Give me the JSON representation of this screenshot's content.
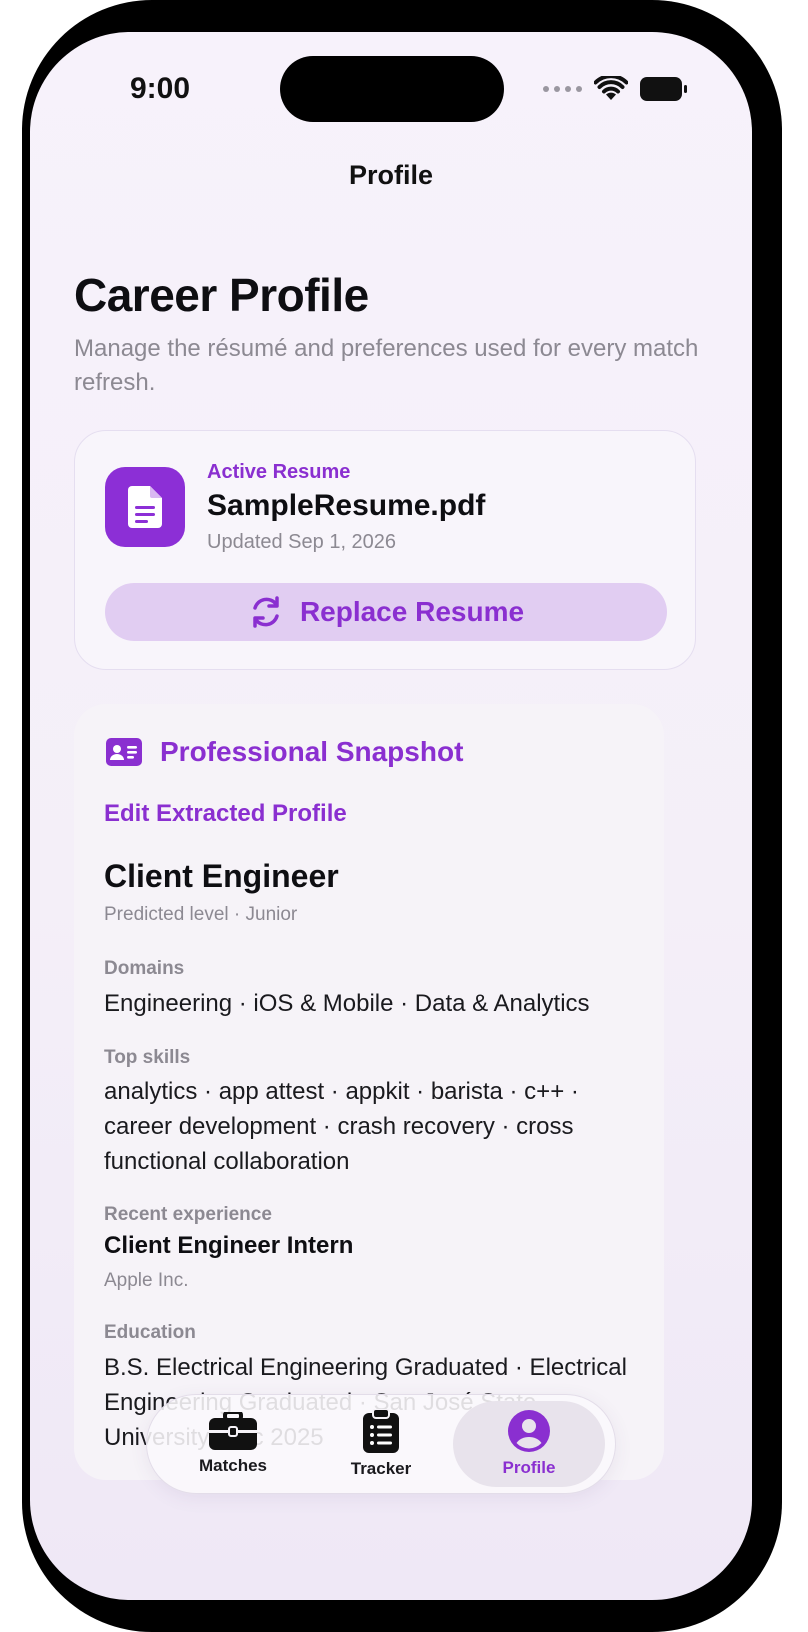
{
  "status_bar": {
    "time": "9:00"
  },
  "nav": {
    "title": "Profile"
  },
  "header": {
    "title": "Career Profile",
    "subtitle": "Manage the résumé and preferences used for every match refresh."
  },
  "resume": {
    "kicker": "Active Resume",
    "file_name": "SampleResume.pdf",
    "updated": "Updated Sep 1, 2026",
    "replace_label": "Replace Resume"
  },
  "snapshot": {
    "title": "Professional Snapshot",
    "edit_label": "Edit Extracted Profile",
    "role": "Client Engineer",
    "level": "Predicted level · Junior",
    "domains_label": "Domains",
    "domains": "Engineering · iOS & Mobile · Data & Analytics",
    "skills_label": "Top skills",
    "skills": "analytics · app attest · appkit · barista · c++ · career development · crash recovery · cross functional collaboration",
    "experience_label": "Recent experience",
    "experience_role": "Client Engineer Intern",
    "experience_company": "Apple Inc.",
    "education_label": "Education",
    "education": "B.S. Electrical Engineering Graduated · Electrical Engineering Graduated · San José State University, Dec 2025"
  },
  "tabbar": {
    "tabs": [
      {
        "label": "Matches",
        "icon": "briefcase-icon"
      },
      {
        "label": "Tracker",
        "icon": "clipboard-icon"
      },
      {
        "label": "Profile",
        "icon": "person-circle-icon"
      }
    ],
    "active": "Profile"
  },
  "colors": {
    "accent": "#8a2fd0",
    "accent_soft": "#e1cdf2",
    "secondary_text": "#8c8992"
  }
}
